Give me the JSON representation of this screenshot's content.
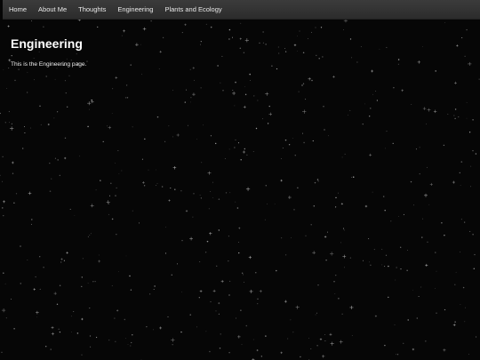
{
  "nav": {
    "items": [
      {
        "label": "Home"
      },
      {
        "label": "About Me"
      },
      {
        "label": "Thoughts"
      },
      {
        "label": "Engineering"
      },
      {
        "label": "Plants and Ecology"
      }
    ]
  },
  "main": {
    "title": "Engineering",
    "body": "This is the Engineering page."
  },
  "colors": {
    "background": "#060606",
    "navbar": "#333333",
    "text": "#ffffff"
  }
}
